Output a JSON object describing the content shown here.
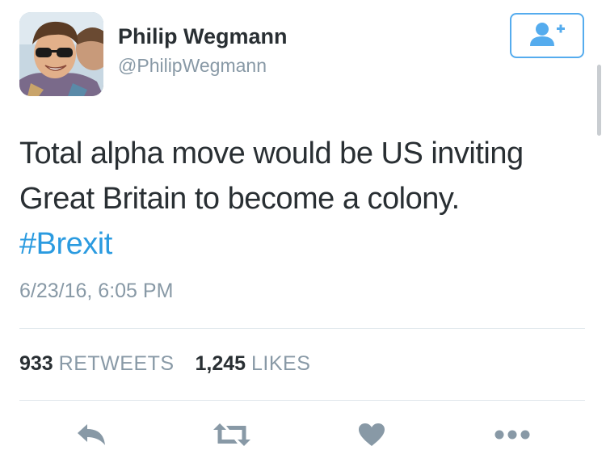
{
  "user": {
    "name": "Philip Wegmann",
    "handle": "@PhilipWegmann"
  },
  "tweet": {
    "lines": [
      "Total alpha move would be US inviting",
      "Great Britain to become a colony."
    ],
    "hashtag": "#Brexit",
    "timestamp": "6/23/16, 6:05 PM"
  },
  "stats": {
    "retweets_count": "933",
    "retweets_label": "RETWEETS",
    "likes_count": "1,245",
    "likes_label": "LIKES"
  },
  "actions": [
    "reply-icon",
    "retweet-icon",
    "heart-icon",
    "more-icon"
  ],
  "colors": {
    "accent": "#55acee",
    "hashtag": "#2b9be0",
    "text": "#292f33",
    "muted": "#8899a6",
    "icon": "#8899a6",
    "divider": "#e1e8ed"
  }
}
